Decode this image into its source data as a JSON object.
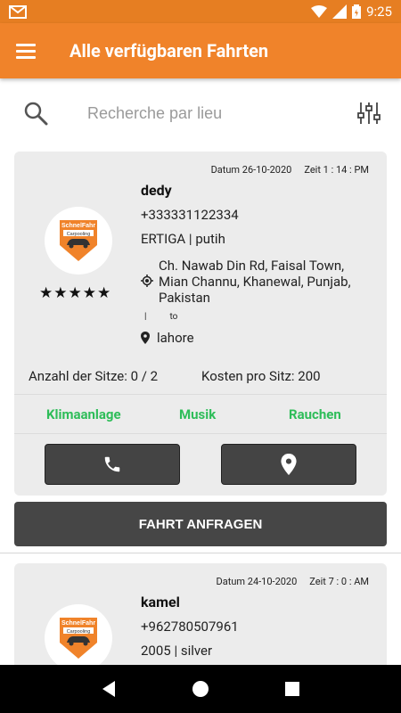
{
  "status_bar": {
    "time": "9:25"
  },
  "header": {
    "title": "Alle verfügbaren Fahrten"
  },
  "search": {
    "placeholder": "Recherche par lieu"
  },
  "rides": [
    {
      "date": "Datum 26-10-2020",
      "time": "Zeit 1 : 14 : PM",
      "name": "dedy",
      "phone": "+333331122334",
      "vehicle": "ERTIGA  |  putih",
      "from": "Ch. Nawab Din Rd, Faisal Town, Mian Channu, Khanewal, Punjab, Pakistan",
      "sep": "|",
      "to_label": "to",
      "to": "lahore",
      "stars": "★★★★★",
      "seats": "Anzahl der Sitze: 0 / 2",
      "cost": "Kosten pro Sitz: 200",
      "amenities": [
        "Klimaanlage",
        "Musik",
        "Rauchen"
      ],
      "logo_text": "SchnelFahr",
      "logo_sub": "Carpooling"
    },
    {
      "date": "Datum 24-10-2020",
      "time": "Zeit 7 : 0 : AM",
      "name": "kamel",
      "phone": "+962780507961",
      "vehicle": "2005  |  silver",
      "logo_text": "SchnelFahr",
      "logo_sub": "Carpooling"
    }
  ],
  "request_button": "FAHRT ANFRAGEN",
  "colors": {
    "primary": "#f0832a",
    "status": "#e67e22",
    "accent_green": "#2ebd59",
    "button_dark": "#464646"
  }
}
